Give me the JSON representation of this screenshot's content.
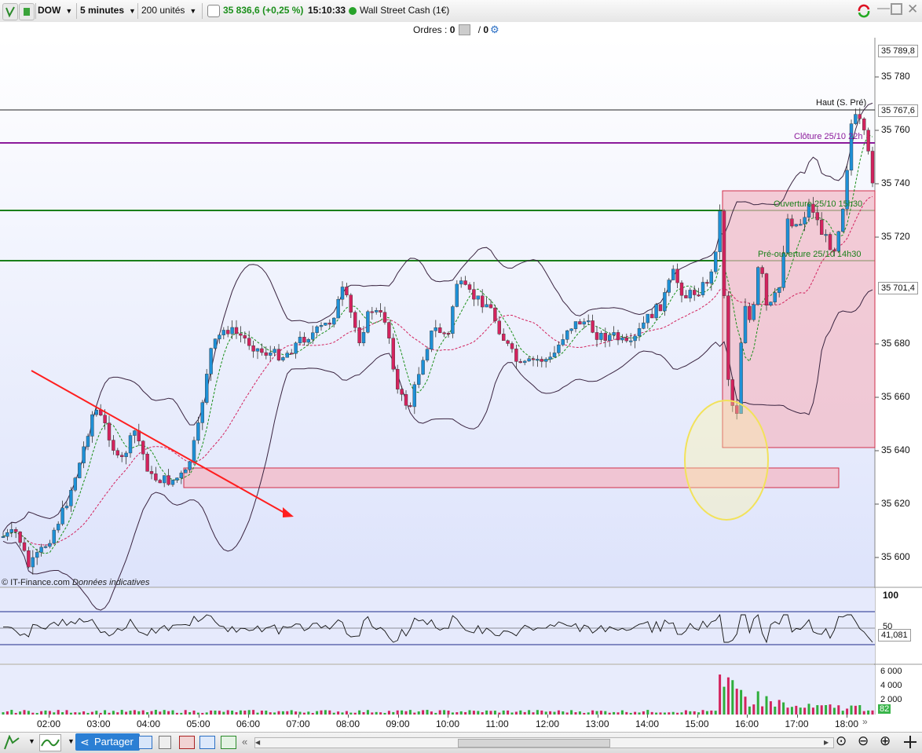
{
  "toolbar": {
    "symbol": "DOW",
    "timeframe": "5 minutes",
    "units": "200 unités",
    "price": "35 836,6",
    "change": "(+0,25 %)",
    "time": "15:10:33",
    "instrument": "Wall Street Cash (1€)"
  },
  "orders": {
    "label": "Ordres :",
    "count1": "0",
    "sep": "/",
    "count2": "0"
  },
  "price_axis": {
    "ticks": [
      "35 780",
      "35 760",
      "35 740",
      "35 720",
      "35 680",
      "35 660",
      "35 640",
      "35 620",
      "35 600"
    ],
    "tag_top": "35 789,8",
    "tag_high": "35 767,6",
    "tag_mid": "35 701,4"
  },
  "annotations": {
    "high": "Haut (S. Pré)",
    "close": "Clôture 25/10 22h",
    "open": "Ouverture 25/10 15h30",
    "preopen": "Pré-ouverture 25/10 14h30",
    "copyright": "© IT-Finance.com",
    "indicative": "Données indicatives"
  },
  "oscillator": {
    "tick_100": "100",
    "tick_50": "50",
    "value": "41,081"
  },
  "volume": {
    "ticks": [
      "6 000",
      "4 000",
      "2 000"
    ],
    "value": "82"
  },
  "time_axis": [
    "02:00",
    "03:00",
    "04:00",
    "05:00",
    "06:00",
    "07:00",
    "08:00",
    "09:00",
    "10:00",
    "11:00",
    "12:00",
    "13:00",
    "14:00",
    "15:00",
    "16:00",
    "17:00",
    "18:00"
  ],
  "bottombar": {
    "share_label": "Partager"
  },
  "colors": {
    "up": "#1e90d6",
    "down": "#d3235e",
    "price_positive": "#1a8f1a",
    "close_line": "#8b1a9b",
    "open_line": "#1a7f1a",
    "zone_fill": "#f2bcc8",
    "trend_line": "#ff1e1e",
    "bollinger": "#3a2440"
  }
}
